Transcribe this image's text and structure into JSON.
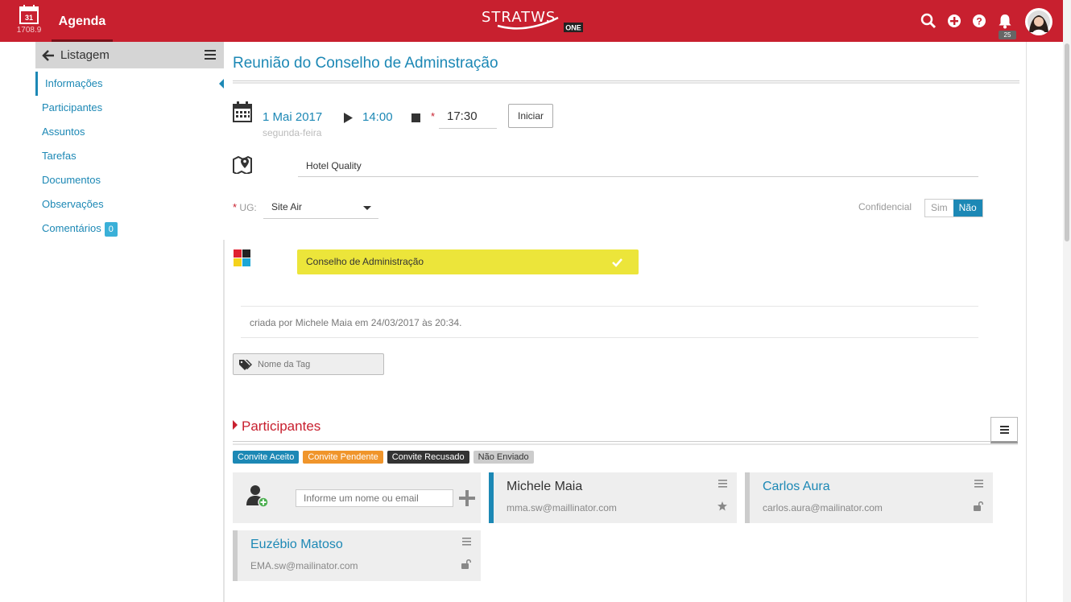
{
  "header": {
    "calendar_day": "31",
    "calendar_sub": "1708.9",
    "app_title": "Agenda",
    "brand": "STRATWS",
    "brand_sub": "ONE",
    "notification_count": "25",
    "accent_color": "#c8202f"
  },
  "sidebar": {
    "title": "Listagem",
    "items": [
      {
        "label": "Informações",
        "active": true
      },
      {
        "label": "Participantes"
      },
      {
        "label": "Assuntos"
      },
      {
        "label": "Tarefas"
      },
      {
        "label": "Documentos"
      },
      {
        "label": "Observações"
      },
      {
        "label": "Comentários",
        "badge": "0"
      }
    ]
  },
  "meeting": {
    "title": "Reunião do Conselho de Adminstração",
    "date": "1 Mai 2017",
    "weekday": "segunda-feira",
    "start_time": "14:00",
    "end_time": "17:30",
    "start_button": "Iniciar",
    "location": "Hotel Quality",
    "ug_label": "UG:",
    "ug_value": "Site Air",
    "confidential_label": "Confidencial",
    "confidential_yes": "Sim",
    "confidential_no": "Não",
    "confidential_selected": "Não",
    "group": "Conselho de Administração",
    "group_color": "#ece53a",
    "created_by": "criada por Michele Maia em 24/03/2017 às 20:34.",
    "tag_placeholder": "Nome da Tag"
  },
  "participants": {
    "title": "Participantes",
    "legend": [
      {
        "label": "Convite Aceito",
        "color": "#1c88b5"
      },
      {
        "label": "Convite Pendente",
        "color": "#f0952b"
      },
      {
        "label": "Convite Recusado",
        "color": "#333333"
      },
      {
        "label": "Não Enviado",
        "color": "#cccccc"
      }
    ],
    "invite_placeholder": "Informe um nome ou email",
    "people": [
      {
        "name": "Michele Maia",
        "email": "mma.sw@maillinator.com",
        "status": "star-icon"
      },
      {
        "name": "Carlos Aura",
        "email": "carlos.aura@mailinator.com",
        "status": "unlock-icon"
      },
      {
        "name": "Euzébio Matoso",
        "email": "EMA.sw@mailinator.com",
        "status": "unlock-icon"
      }
    ]
  }
}
